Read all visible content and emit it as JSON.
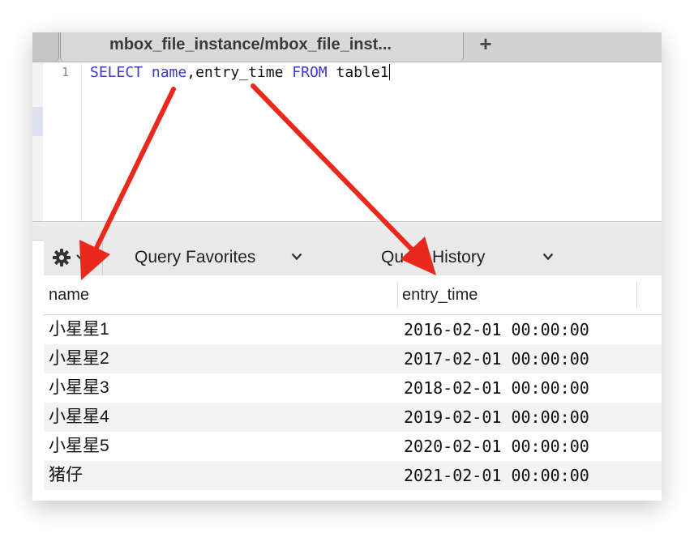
{
  "tab": {
    "title": "mbox_file_instance/mbox_file_inst...",
    "add_label": "+"
  },
  "editor": {
    "line_number": "1",
    "kw_select": "SELECT",
    "col_name": "name",
    "sep_rest": ",entry_time ",
    "kw_from": "FROM",
    "table": " table1"
  },
  "toolbar": {
    "gear_icon": "gear-icon",
    "favorites_label": "Query Favorites",
    "history_label": "Query History"
  },
  "results": {
    "columns": [
      "name",
      "entry_time"
    ],
    "rows": [
      {
        "name": "小星星1",
        "entry_time": "2016-02-01 00:00:00"
      },
      {
        "name": "小星星2",
        "entry_time": "2017-02-01 00:00:00"
      },
      {
        "name": "小星星3",
        "entry_time": "2018-02-01 00:00:00"
      },
      {
        "name": "小星星4",
        "entry_time": "2019-02-01 00:00:00"
      },
      {
        "name": "小星星5",
        "entry_time": "2020-02-01 00:00:00"
      },
      {
        "name": "猪仔",
        "entry_time": "2021-02-01 00:00:00"
      }
    ]
  },
  "colors": {
    "keyword": "#3a3ad0",
    "arrow": "#e8291c"
  }
}
